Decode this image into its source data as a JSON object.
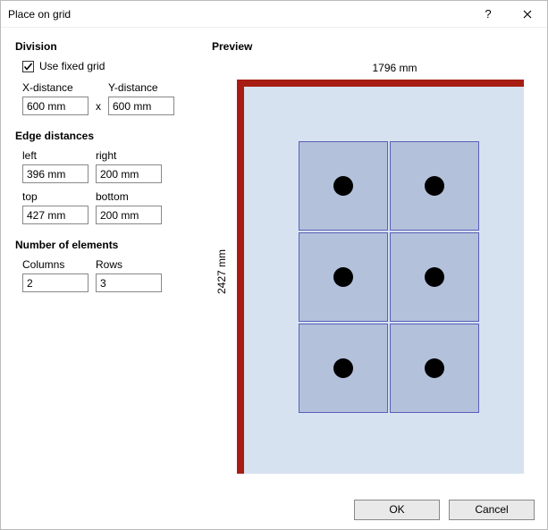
{
  "titlebar": {
    "title": "Place on grid"
  },
  "division": {
    "header": "Division",
    "use_fixed_grid_label": "Use fixed grid",
    "use_fixed_grid_checked": true,
    "x_distance_label": "X-distance",
    "x_distance_value": "600 mm",
    "y_distance_label": "Y-distance",
    "y_distance_value": "600 mm",
    "separator": "x"
  },
  "edge": {
    "header": "Edge distances",
    "left_label": "left",
    "left_value": "396 mm",
    "right_label": "right",
    "right_value": "200 mm",
    "top_label": "top",
    "top_value": "427 mm",
    "bottom_label": "bottom",
    "bottom_value": "200 mm"
  },
  "count": {
    "header": "Number of elements",
    "columns_label": "Columns",
    "columns_value": "2",
    "rows_label": "Rows",
    "rows_value": "3"
  },
  "preview": {
    "header": "Preview",
    "width_label": "1796 mm",
    "height_label": "2427 mm"
  },
  "buttons": {
    "ok": "OK",
    "cancel": "Cancel"
  }
}
